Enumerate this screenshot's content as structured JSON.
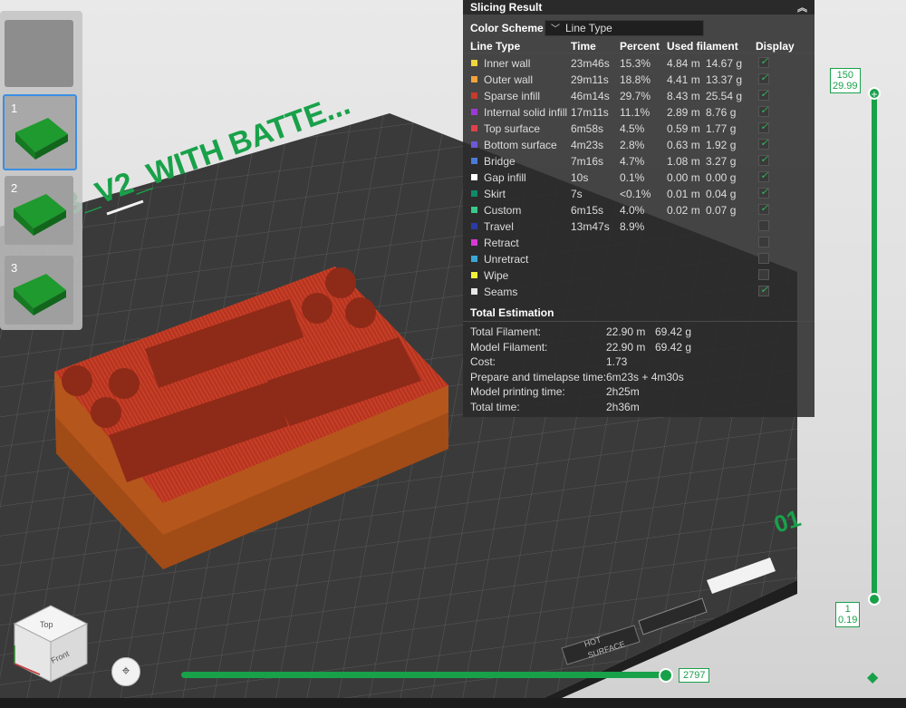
{
  "plate_label_text": "3_V2_WITH BATTE...",
  "plate_number": "01",
  "bed_labels": {
    "hot_surface_top": "HOT",
    "hot_surface_bottom": "SURFACE"
  },
  "plates": [
    {
      "number": "",
      "state": "empty"
    },
    {
      "number": "1",
      "state": "active"
    },
    {
      "number": "2",
      "state": "normal"
    },
    {
      "number": "3",
      "state": "normal"
    }
  ],
  "result": {
    "title": "Slicing Result",
    "color_scheme_label": "Color Scheme",
    "color_scheme_value": "Line Type",
    "columns": {
      "line_type": "Line Type",
      "time": "Time",
      "percent": "Percent",
      "used_filament": "Used filament",
      "display": "Display"
    },
    "rows": [
      {
        "name": "Inner wall",
        "time": "23m46s",
        "percent": "15.3%",
        "len": "4.84 m",
        "weight": "14.67 g",
        "color": "#f2d43a",
        "checked": true
      },
      {
        "name": "Outer wall",
        "time": "29m11s",
        "percent": "18.8%",
        "len": "4.41 m",
        "weight": "13.37 g",
        "color": "#f2a33a",
        "checked": true
      },
      {
        "name": "Sparse infill",
        "time": "46m14s",
        "percent": "29.7%",
        "len": "8.43 m",
        "weight": "25.54 g",
        "color": "#c83a2a",
        "checked": true
      },
      {
        "name": "Internal solid infill",
        "time": "17m11s",
        "percent": "11.1%",
        "len": "2.89 m",
        "weight": "8.76 g",
        "color": "#9b3ad1",
        "checked": true
      },
      {
        "name": "Top surface",
        "time": "6m58s",
        "percent": "4.5%",
        "len": "0.59 m",
        "weight": "1.77 g",
        "color": "#e0404a",
        "checked": true
      },
      {
        "name": "Bottom surface",
        "time": "4m23s",
        "percent": "2.8%",
        "len": "0.63 m",
        "weight": "1.92 g",
        "color": "#6a5ad6",
        "checked": true
      },
      {
        "name": "Bridge",
        "time": "7m16s",
        "percent": "4.7%",
        "len": "1.08 m",
        "weight": "3.27 g",
        "color": "#4a7ad6",
        "checked": true
      },
      {
        "name": "Gap infill",
        "time": "10s",
        "percent": "0.1%",
        "len": "0.00 m",
        "weight": "0.00 g",
        "color": "#ffffff",
        "checked": true
      },
      {
        "name": "Skirt",
        "time": "7s",
        "percent": "<0.1%",
        "len": "0.01 m",
        "weight": "0.04 g",
        "color": "#0e8a6a",
        "checked": true
      },
      {
        "name": "Custom",
        "time": "6m15s",
        "percent": "4.0%",
        "len": "0.02 m",
        "weight": "0.07 g",
        "color": "#3ac88a",
        "checked": true
      },
      {
        "name": "Travel",
        "time": "13m47s",
        "percent": "8.9%",
        "len": "",
        "weight": "",
        "color": "#2a3aa8",
        "checked": false
      },
      {
        "name": "Retract",
        "time": "",
        "percent": "",
        "len": "",
        "weight": "",
        "color": "#d63ad6",
        "checked": false
      },
      {
        "name": "Unretract",
        "time": "",
        "percent": "",
        "len": "",
        "weight": "",
        "color": "#3aa8d6",
        "checked": false
      },
      {
        "name": "Wipe",
        "time": "",
        "percent": "",
        "len": "",
        "weight": "",
        "color": "#f2f23a",
        "checked": false
      },
      {
        "name": "Seams",
        "time": "",
        "percent": "",
        "len": "",
        "weight": "",
        "color": "#e6e6e6",
        "checked": true
      }
    ],
    "estimation_title": "Total Estimation",
    "estimation": [
      {
        "label": "Total Filament:",
        "v1": "22.90 m",
        "v2": "69.42 g"
      },
      {
        "label": "Model Filament:",
        "v1": "22.90 m",
        "v2": "69.42 g"
      },
      {
        "label": "Cost:",
        "v1": "1.73",
        "v2": ""
      },
      {
        "label": "Prepare and timelapse time:",
        "v1": "6m23s + 4m30s",
        "v2": ""
      },
      {
        "label": "Model printing time:",
        "v1": "2h25m",
        "v2": ""
      },
      {
        "label": "Total time:",
        "v1": "2h36m",
        "v2": ""
      }
    ]
  },
  "layer_slider": {
    "top_layer": "150",
    "top_height": "29.99",
    "bottom_layer": "1",
    "bottom_height": "0.19"
  },
  "move_slider": {
    "value": "2797"
  },
  "view_cube": {
    "top": "Top",
    "front": "Front"
  }
}
